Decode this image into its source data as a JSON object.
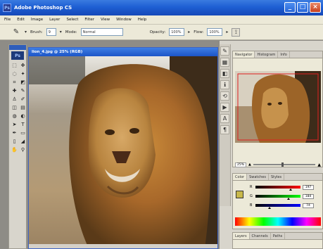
{
  "window": {
    "title": "Adobe Photoshop CS",
    "app_icon_label": "Ps",
    "minimize_glyph": "_",
    "maximize_glyph": "□",
    "close_glyph": "×"
  },
  "menu": [
    "File",
    "Edit",
    "Image",
    "Layer",
    "Select",
    "Filter",
    "View",
    "Window",
    "Help"
  ],
  "options": {
    "brush_label": "Brush:",
    "brush_size": "9",
    "mode_label": "Mode:",
    "mode_value": "Normal",
    "opacity_label": "Opacity:",
    "opacity_value": "100%",
    "flow_label": "Flow:",
    "flow_value": "100%"
  },
  "toolbox": {
    "logo": "Ps",
    "tools": [
      "marquee-icon",
      "move-icon",
      "lasso-icon",
      "magic-wand-icon",
      "crop-icon",
      "slice-icon",
      "healing-brush-icon",
      "brush-icon",
      "clone-stamp-icon",
      "history-brush-icon",
      "eraser-icon",
      "gradient-icon",
      "blur-icon",
      "dodge-icon",
      "path-selection-icon",
      "type-icon",
      "pen-icon",
      "shape-icon",
      "notes-icon",
      "eyedropper-icon",
      "hand-icon",
      "zoom-icon"
    ],
    "tool_glyphs": [
      "⬚",
      "✥",
      "◌",
      "✦",
      "⌗",
      "◩",
      "✚",
      "✎",
      "♙",
      "✐",
      "◫",
      "▤",
      "◍",
      "◐",
      "➤",
      "T",
      "✒",
      "▭",
      "▯",
      "◢",
      "✋",
      "⚲"
    ]
  },
  "document": {
    "title": "lion_4.jpg @ 25% (RGB)"
  },
  "panel_strip_icons": [
    "brushes-icon",
    "tool-presets-icon",
    "layer-comps-icon",
    "info-icon",
    "history-icon",
    "actions-icon",
    "character-icon",
    "paragraph-icon"
  ],
  "panel_strip_glyphs": [
    "✎",
    "▦",
    "◧",
    "ℹ",
    "⟲",
    "▶",
    "A",
    "¶"
  ],
  "navigator": {
    "tabs": [
      "Navigator",
      "Histogram",
      "Info"
    ],
    "zoom": "25%"
  },
  "color_panel": {
    "tabs": [
      "Color",
      "Swatches",
      "Styles"
    ],
    "sliders": [
      {
        "letter": "R",
        "value": "197",
        "from": "#000000",
        "to": "#ff0000",
        "pos": 0.77
      },
      {
        "letter": "G",
        "value": "184",
        "from": "#000000",
        "to": "#00ff00",
        "pos": 0.72
      },
      {
        "letter": "B",
        "value": "74",
        "from": "#000000",
        "to": "#0000ff",
        "pos": 0.29
      }
    ],
    "foreground": "#c8b84a",
    "background": "#ffffff"
  },
  "layers_panel": {
    "tabs": [
      "Layers",
      "Channels",
      "Paths"
    ]
  },
  "colors": {
    "title_blue": "#1e5fd3",
    "chrome": "#ece9d8",
    "workspace": "#8e8c86"
  }
}
